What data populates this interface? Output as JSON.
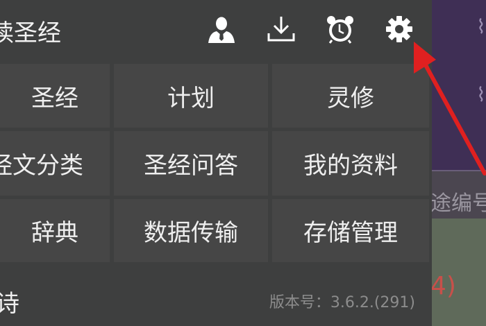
{
  "background": {
    "search_fragment": "途编号",
    "code_fragment": "4)"
  },
  "header": {
    "title": "读圣经",
    "icons": [
      "user-icon",
      "download-icon",
      "alarm-icon",
      "settings-icon"
    ]
  },
  "menu": {
    "items": [
      {
        "label": "圣经"
      },
      {
        "label": "计划"
      },
      {
        "label": "灵修"
      },
      {
        "label": "经文分类"
      },
      {
        "label": "圣经问答"
      },
      {
        "label": "我的资料"
      },
      {
        "label": "辞典"
      },
      {
        "label": "数据传输"
      },
      {
        "label": "存储管理"
      }
    ]
  },
  "footer": {
    "left_label": "诗",
    "version": "版本号：3.6.2.(291)"
  },
  "annotation": {
    "arrow_color": "#e02020"
  }
}
